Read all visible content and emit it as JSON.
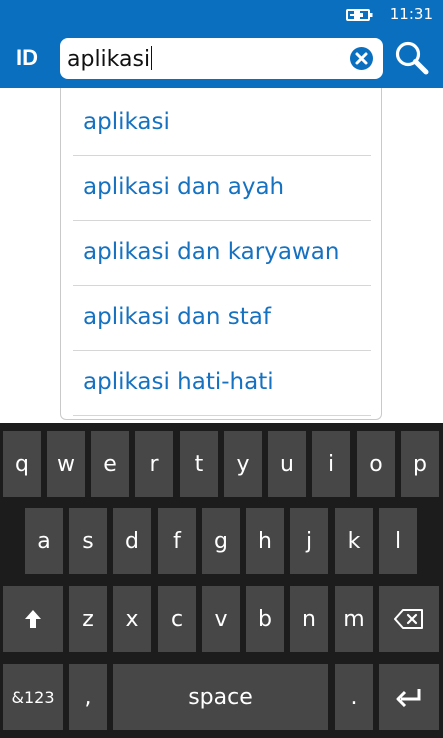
{
  "status_bar": {
    "time": "11:31",
    "battery_icon": "battery-charging-icon"
  },
  "header": {
    "language": "ID",
    "search_value": "aplikasi",
    "clear_icon": "clear-icon",
    "search_icon": "search-icon"
  },
  "suggestions": [
    {
      "label": "aplikasi"
    },
    {
      "label": "aplikasi dan ayah"
    },
    {
      "label": "aplikasi dan karyawan"
    },
    {
      "label": "aplikasi dan staf"
    },
    {
      "label": "aplikasi hati-hati"
    }
  ],
  "keyboard": {
    "row1": [
      "q",
      "w",
      "e",
      "r",
      "t",
      "y",
      "u",
      "i",
      "o",
      "p"
    ],
    "row2": [
      "a",
      "s",
      "d",
      "f",
      "g",
      "h",
      "j",
      "k",
      "l"
    ],
    "row3": [
      "z",
      "x",
      "c",
      "v",
      "b",
      "n",
      "m"
    ],
    "shift_icon": "shift-arrow-icon",
    "backspace_icon": "backspace-icon",
    "numbers_label": "&123",
    "comma_label": ",",
    "space_label": "space",
    "period_label": ".",
    "enter_icon": "enter-icon"
  },
  "colors": {
    "accent": "#0b6fc0",
    "suggestion_text": "#1672c1",
    "keyboard_bg": "#1c1c1c",
    "key_bg": "#474747"
  }
}
